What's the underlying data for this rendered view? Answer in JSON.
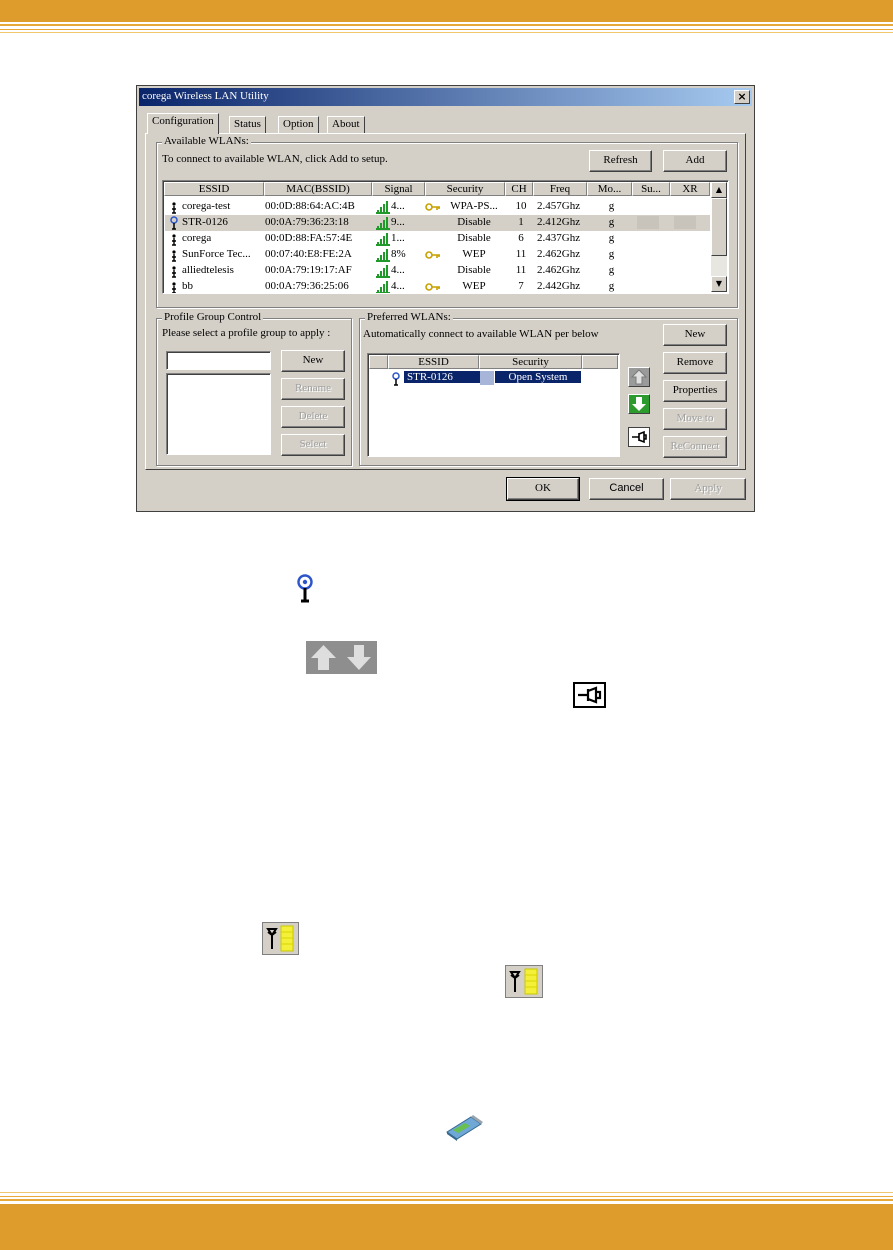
{
  "dialog": {
    "title": "corega Wireless LAN Utility",
    "close": "×",
    "tabs": [
      "Configuration",
      "Status",
      "Option",
      "About"
    ],
    "available": {
      "legend": "Available WLANs:",
      "hint": "To connect to available WLAN, click Add to setup.",
      "refresh": "Refresh",
      "add": "Add",
      "columns": [
        "ESSID",
        "MAC(BSSID)",
        "Signal",
        "Security",
        "CH",
        "Freq",
        "Mo...",
        "Su...",
        "XR"
      ],
      "rows": [
        {
          "essid": "corega-test",
          "mac": "00:0D:88:64:AC:4B",
          "signal": "4...",
          "security": "WPA-PS...",
          "ch": "10",
          "freq": "2.457Ghz",
          "mode": "g",
          "lock": true
        },
        {
          "essid": "STR-0126",
          "mac": "00:0A:79:36:23:18",
          "signal": "9...",
          "security": "Disable",
          "ch": "1",
          "freq": "2.412Ghz",
          "mode": "g",
          "lock": false
        },
        {
          "essid": "corega",
          "mac": "00:0D:88:FA:57:4E",
          "signal": "1...",
          "security": "Disable",
          "ch": "6",
          "freq": "2.437Ghz",
          "mode": "g",
          "lock": false
        },
        {
          "essid": "SunForce Tec...",
          "mac": "00:07:40:E8:FE:2A",
          "signal": "8%",
          "security": "WEP",
          "ch": "11",
          "freq": "2.462Ghz",
          "mode": "g",
          "lock": true
        },
        {
          "essid": "alliedtelesis",
          "mac": "00:0A:79:19:17:AF",
          "signal": "4...",
          "security": "Disable",
          "ch": "11",
          "freq": "2.462Ghz",
          "mode": "g",
          "lock": false
        },
        {
          "essid": "bb",
          "mac": "00:0A:79:36:25:06",
          "signal": "4...",
          "security": "WEP",
          "ch": "7",
          "freq": "2.442Ghz",
          "mode": "g",
          "lock": true
        }
      ]
    },
    "profile": {
      "legend": "Profile Group Control",
      "hint": "Please select a profile group to apply :",
      "input_value": "",
      "new": "New",
      "rename": "Rename",
      "delete": "Delete",
      "select": "Select"
    },
    "preferred": {
      "legend": "Preferred WLANs:",
      "hint": "Automatically connect to available WLAN per below",
      "columns": [
        "ESSID",
        "Security"
      ],
      "rows": [
        {
          "essid": "STR-0126",
          "security": "Open System"
        }
      ],
      "new": "New",
      "remove": "Remove",
      "properties": "Properties",
      "move_to": "Move to",
      "reconnect": "ReConnect"
    },
    "ok": "OK",
    "cancel": "Cancel",
    "apply": "Apply"
  },
  "colors": {
    "band": "#dd9c2c",
    "selection": "#0a246a",
    "title_start": "#0a246a",
    "title_end": "#a6caf0"
  },
  "icons": [
    "connected-ap-icon",
    "move-up-arrow-icon",
    "move-down-arrow-icon",
    "pin-icon",
    "signal-strength-yellow-icon",
    "signal-strength-yellow-icon",
    "wireless-card-icon"
  ]
}
